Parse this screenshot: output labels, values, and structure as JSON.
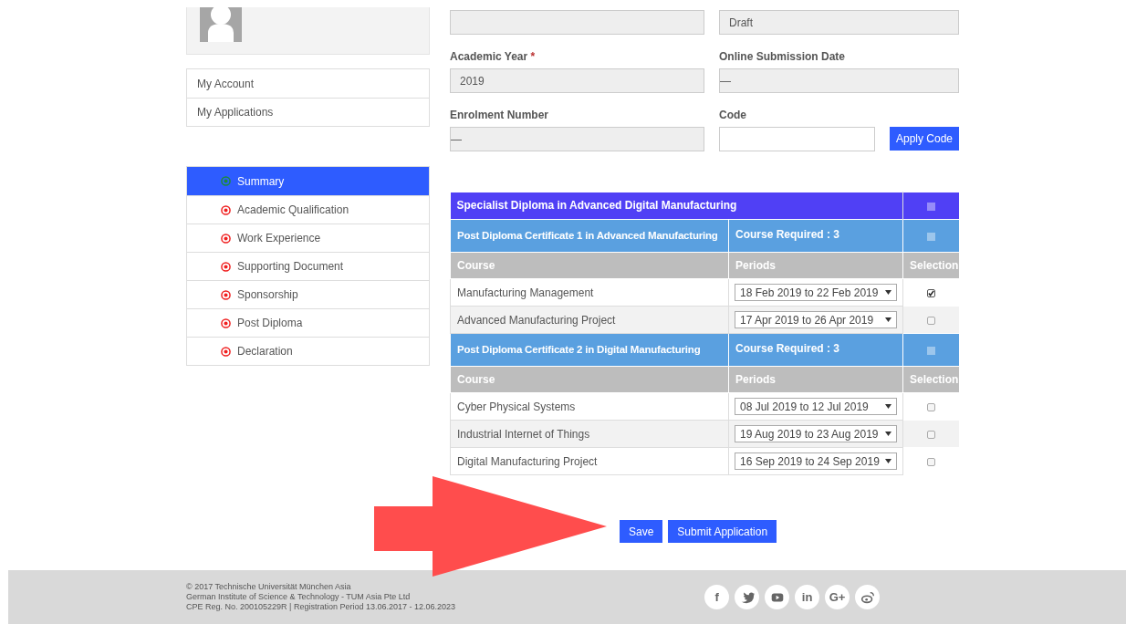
{
  "profile": {
    "kind": "avatar"
  },
  "account_menu": [
    {
      "label": "My Account"
    },
    {
      "label": "My Applications"
    }
  ],
  "steps": [
    {
      "label": "Summary",
      "selected": true,
      "complete": true
    },
    {
      "label": "Academic Qualification",
      "selected": false,
      "complete": false
    },
    {
      "label": "Work Experience",
      "selected": false,
      "complete": false
    },
    {
      "label": "Supporting Document",
      "selected": false,
      "complete": false
    },
    {
      "label": "Sponsorship",
      "selected": false,
      "complete": false
    },
    {
      "label": "Post Diploma",
      "selected": false,
      "complete": false
    },
    {
      "label": "Declaration",
      "selected": false,
      "complete": false
    }
  ],
  "form": {
    "status": "Draft",
    "academic_year_label": "Academic Year",
    "required_mark": "*",
    "academic_year": "2019",
    "submission_date_label": "Online Submission Date",
    "submission_date": "—",
    "enrolment_label": "Enrolment Number",
    "enrolment": "—",
    "code_label": "Code",
    "apply_button": "Apply Code"
  },
  "programme": {
    "title": "Specialist Diploma in Advanced Digital Manufacturing",
    "checked": false,
    "certificates": [
      {
        "title": "Post Diploma Certificate 1 in Advanced Manufacturing",
        "checked": false,
        "required": "Course Required : 3",
        "columns": [
          "Course",
          "Periods",
          "Selection"
        ],
        "rows": [
          {
            "course": "Manufacturing Management",
            "period": "18 Feb 2019 to 22 Feb 2019",
            "checked": true
          },
          {
            "course": "Advanced Manufacturing Project",
            "period": "17 Apr 2019 to 26 Apr 2019",
            "checked": false
          }
        ]
      },
      {
        "title": "Post Diploma Certificate 2 in Digital Manufacturing",
        "checked": false,
        "required": "Course Required : 3",
        "columns": [
          "Course",
          "Periods",
          "Selection"
        ],
        "rows": [
          {
            "course": "Cyber Physical Systems",
            "period": "08 Jul 2019 to 12 Jul 2019",
            "checked": false
          },
          {
            "course": "Industrial Internet of Things",
            "period": "19 Aug 2019 to 23 Aug 2019",
            "checked": false
          },
          {
            "course": "Digital Manufacturing Project",
            "period": "16 Sep 2019 to 24 Sep 2019",
            "checked": false
          }
        ]
      }
    ]
  },
  "actions": [
    "Save",
    "Submit Application"
  ],
  "footer": {
    "lines": [
      "© 2017 Technische Universität München Asia",
      "German Institute of Science & Technology - TUM Asia Pte Ltd",
      "CPE Reg. No. 200105229R | Registration Period 13.06.2017 - 12.06.2023"
    ],
    "social": [
      {
        "kind": "facebook",
        "glyph": "f"
      },
      {
        "kind": "twitter"
      },
      {
        "kind": "youtube"
      },
      {
        "kind": "linkedin",
        "glyph": "in"
      },
      {
        "kind": "googleplus",
        "glyph": "G+"
      },
      {
        "kind": "weibo"
      }
    ]
  }
}
